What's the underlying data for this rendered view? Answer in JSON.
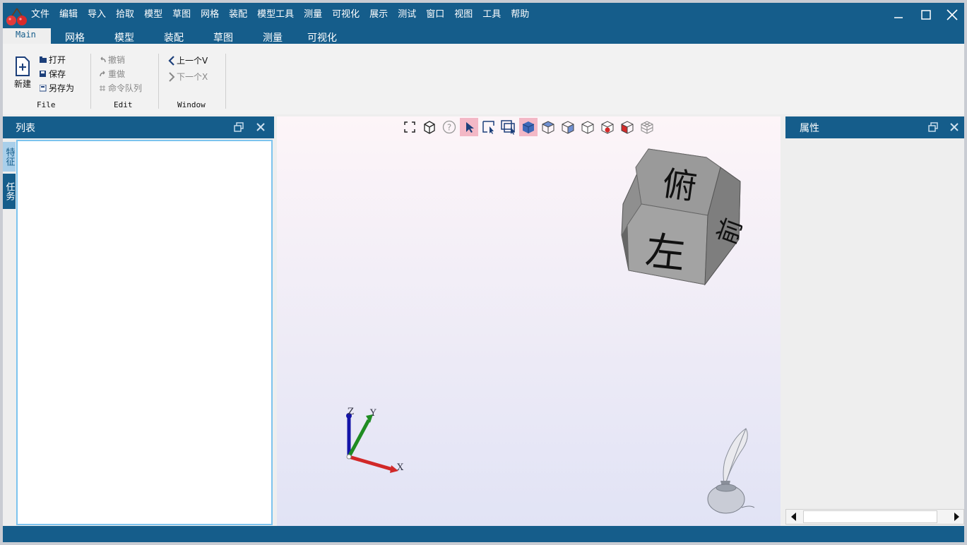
{
  "colors": {
    "accent": "#155d8b",
    "list_border": "#7cc3ee"
  },
  "menu": [
    "文件",
    "编辑",
    "导入",
    "拾取",
    "模型",
    "草图",
    "网格",
    "装配",
    "模型工具",
    "测量",
    "可视化",
    "展示",
    "测试",
    "窗口",
    "视图",
    "工具",
    "帮助"
  ],
  "tabs": [
    "Main",
    "网格",
    "模型",
    "装配",
    "草图",
    "测量",
    "可视化"
  ],
  "ribbon": {
    "file": {
      "new": "新建",
      "open": "打开",
      "save": "保存",
      "save_as": "另存为",
      "group": "File"
    },
    "edit": {
      "undo": "撤销",
      "redo": "重做",
      "queue": "命令队列",
      "group": "Edit"
    },
    "window": {
      "prev": "上一个V",
      "next": "下一个X",
      "group": "Window"
    }
  },
  "left_panel": {
    "title": "列表",
    "vtabs": [
      "特征",
      "任务"
    ]
  },
  "right_panel": {
    "title": "属性"
  },
  "viewcube": {
    "top": "俯",
    "left": "左",
    "front": "前"
  },
  "axes": {
    "x": "X",
    "y": "Y",
    "z": "Z"
  },
  "icons": [
    "fit-view-icon",
    "iso-box-icon",
    "help-icon",
    "select-arrow-icon",
    "box-select-icon",
    "multi-select-icon",
    "view-solid-icon",
    "view-top-icon",
    "view-front-icon",
    "view-right-icon",
    "view-red1-icon",
    "view-red2-icon",
    "view-wire-icon"
  ]
}
